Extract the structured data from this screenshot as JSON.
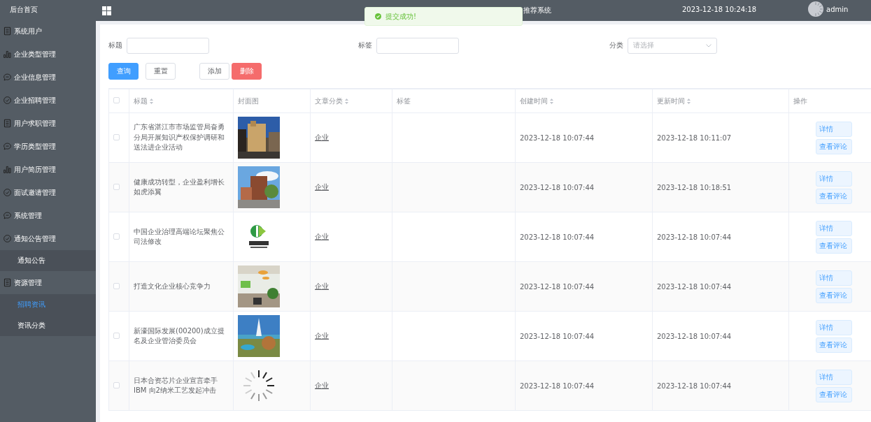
{
  "header": {
    "title": "推荐系统",
    "datetime": "2023-12-18 10:24:18",
    "user": "admin"
  },
  "toast": {
    "message": "提交成功!"
  },
  "sidebar": {
    "home": "后台首页",
    "items": [
      {
        "label": "系统用户"
      },
      {
        "label": "企业类型管理"
      },
      {
        "label": "企业信息管理"
      },
      {
        "label": "企业招聘管理"
      },
      {
        "label": "用户求职管理"
      },
      {
        "label": "学历类型管理"
      },
      {
        "label": "用户简历管理"
      },
      {
        "label": "面试邀请管理"
      },
      {
        "label": "系统管理"
      },
      {
        "label": "通知公告管理",
        "children": [
          {
            "label": "通知公告",
            "selected": false
          }
        ]
      },
      {
        "label": "资源管理",
        "children": [
          {
            "label": "招聘资讯",
            "selected": true
          },
          {
            "label": "资讯分类",
            "selected": false
          }
        ]
      }
    ]
  },
  "filters": [
    {
      "label": "标题",
      "kind": "input"
    },
    {
      "label": "标签",
      "kind": "input"
    },
    {
      "label": "分类",
      "kind": "select",
      "placeholder": "请选择"
    }
  ],
  "buttons": [
    {
      "label": "查询",
      "kind": "primary"
    },
    {
      "label": "重置",
      "kind": "plain"
    },
    {
      "label": "添加",
      "kind": "plain"
    },
    {
      "label": "删除",
      "kind": "danger"
    }
  ],
  "table": {
    "columns": [
      {
        "label": "标题",
        "sortable": true
      },
      {
        "label": "封面图",
        "sortable": false
      },
      {
        "label": "文章分类",
        "sortable": true
      },
      {
        "label": "标签",
        "sortable": false
      },
      {
        "label": "创建时间",
        "sortable": true
      },
      {
        "label": "更新时间",
        "sortable": true
      },
      {
        "label": "操作",
        "sortable": false
      }
    ],
    "select_all": {
      "checked": false
    },
    "rows": [
      {
        "checked": false,
        "title": "广东省湛江市市场监管局奋勇分局开展知识产权保护调研和送法进企业活动",
        "cover": {
          "kind": "picture"
        },
        "category": "企业",
        "created": "2023-12-18 10:07:44",
        "updated": "2023-12-18 10:11:07",
        "actions": [
          "详情",
          "查看评论"
        ]
      },
      {
        "checked": false,
        "title": "健康成功转型，企业盈利增长如虎添翼",
        "cover": {
          "kind": "picture"
        },
        "category": "企业",
        "created": "2023-12-18 10:07:44",
        "updated": "2023-12-18 10:18:51",
        "actions": [
          "详情",
          "查看评论"
        ]
      },
      {
        "checked": false,
        "title": "中国企业治理高端论坛聚焦公司法修改",
        "cover": {
          "kind": "picture"
        },
        "category": "企业",
        "created": "2023-12-18 10:07:44",
        "updated": "2023-12-18 10:07:44",
        "actions": [
          "详情",
          "查看评论"
        ]
      },
      {
        "checked": false,
        "title": "打造文化企业核心竞争力",
        "cover": {
          "kind": "picture"
        },
        "category": "企业",
        "created": "2023-12-18 10:07:44",
        "updated": "2023-12-18 10:07:44",
        "actions": [
          "详情",
          "查看评论"
        ]
      },
      {
        "checked": false,
        "title": "新濠国际发展(00200)成立提名及企业管治委员会",
        "cover": {
          "kind": "picture"
        },
        "category": "企业",
        "created": "2023-12-18 10:07:44",
        "updated": "2023-12-18 10:07:44",
        "actions": [
          "详情",
          "查看评论"
        ]
      },
      {
        "checked": false,
        "title": "日本合资芯片企业宣言牵手IBM 向2纳米工艺发起冲击",
        "cover": {
          "kind": "spinner"
        },
        "category": "企业",
        "created": "2023-12-18 10:07:44",
        "updated": "2023-12-18 10:07:44",
        "actions": [
          "详情",
          "查看评论"
        ]
      }
    ]
  }
}
